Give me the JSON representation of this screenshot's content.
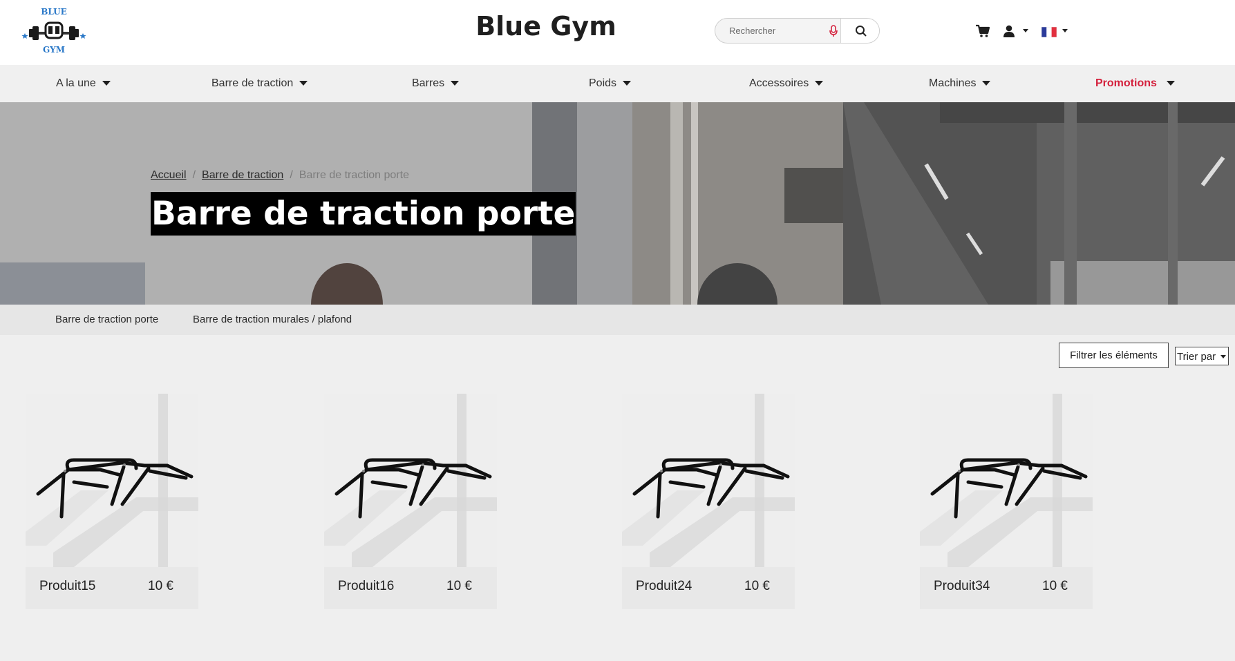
{
  "header": {
    "logo_text_top": "BLUE",
    "logo_text_bottom": "GYM",
    "title": "Blue Gym",
    "search_placeholder": "Rechercher"
  },
  "nav": {
    "items": [
      {
        "label": "A la une"
      },
      {
        "label": "Barre de traction"
      },
      {
        "label": "Barres"
      },
      {
        "label": "Poids"
      },
      {
        "label": "Accessoires"
      },
      {
        "label": "Machines"
      },
      {
        "label": "Promotions"
      }
    ]
  },
  "breadcrumb": {
    "home": "Accueil",
    "category": "Barre de traction",
    "current": "Barre de traction porte",
    "separator": "/"
  },
  "hero": {
    "title": "Barre de traction porte"
  },
  "subcategories": [
    {
      "label": "Barre de traction porte"
    },
    {
      "label": "Barre de traction murales / plafond"
    }
  ],
  "toolbar": {
    "filter_label": "Filtrer les éléments",
    "sort_label": "Trier par"
  },
  "products": [
    {
      "name": "Produit15",
      "price": "10 €"
    },
    {
      "name": "Produit16",
      "price": "10 €"
    },
    {
      "name": "Produit24",
      "price": "10 €"
    },
    {
      "name": "Produit34",
      "price": "10 €"
    }
  ],
  "colors": {
    "brand_blue": "#2a78c8",
    "promo_red": "#d4213d",
    "nav_bg": "#f0f0f0",
    "page_bg": "#efefef"
  },
  "icons": [
    "cart-icon",
    "user-icon",
    "flag-fr-icon",
    "search-icon",
    "microphone-icon",
    "chevron-down-icon"
  ]
}
